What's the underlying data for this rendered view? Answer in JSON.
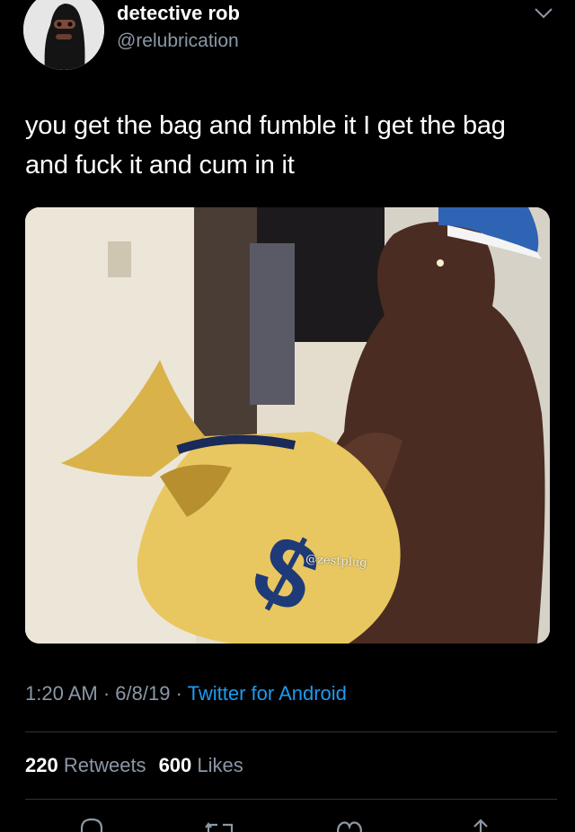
{
  "tweet": {
    "author": {
      "display_name": "detective rob",
      "handle": "@relubrication"
    },
    "text": "you get the bag and fumble it I get the bag and fuck it and cum in it",
    "media": {
      "watermark": "@zestplug"
    },
    "time": "1:20 AM",
    "separator": " · ",
    "date": "6/8/19",
    "source": "Twitter for Android",
    "stats": {
      "retweets_count": "220",
      "retweets_label": "Retweets",
      "likes_count": "600",
      "likes_label": "Likes"
    }
  },
  "icons": {
    "menu": "chevron-down-icon",
    "reply": "reply-icon",
    "retweet": "retweet-icon",
    "like": "heart-icon",
    "share": "share-icon"
  },
  "colors": {
    "background": "#000000",
    "secondary_text": "#8b98a5",
    "link": "#1d9bf0",
    "divider": "#2f3336"
  }
}
